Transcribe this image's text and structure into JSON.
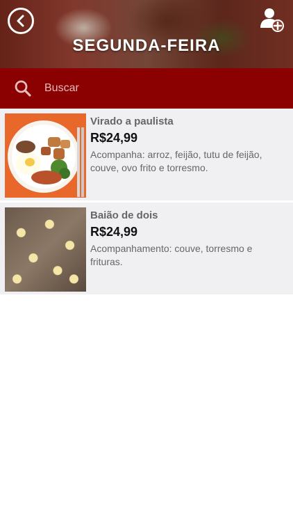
{
  "header": {
    "title": "SEGUNDA-FEIRA",
    "back_icon": "chevron-left-icon",
    "add_user_icon": "add-user-icon"
  },
  "search": {
    "placeholder": "Buscar",
    "value": "",
    "icon": "search-icon"
  },
  "items": [
    {
      "name": "Virado a paulista",
      "price": "R$24,99",
      "description": "Acompanha: arroz, feijão, tutu de feijão, couve, ovo frito e torresmo."
    },
    {
      "name": "Baião de dois",
      "price": "R$24,99",
      "description": "Acompanhamento: couve, torresmo e frituras."
    }
  ],
  "colors": {
    "accent": "#8b0000",
    "list_bg": "#f0f0f2",
    "text_muted": "#666666"
  }
}
